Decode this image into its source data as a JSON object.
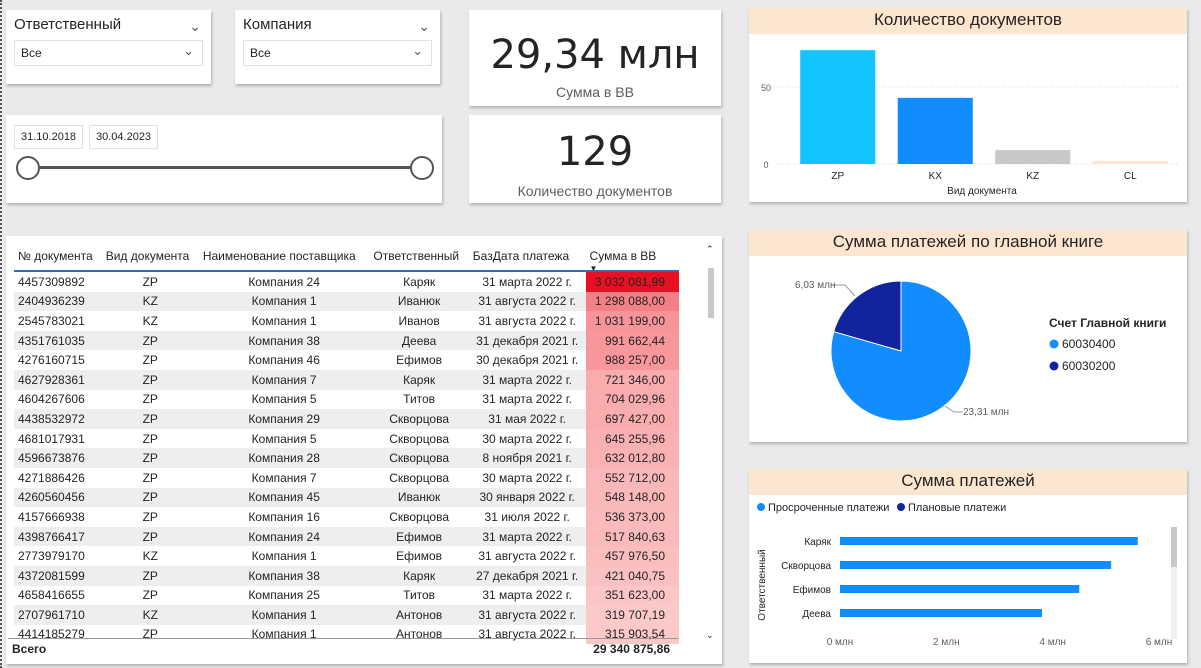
{
  "slicer_responsible": {
    "title": "Ответственный",
    "value": "Все"
  },
  "slicer_company": {
    "title": "Компания",
    "value": "Все"
  },
  "date_range": {
    "start": "31.10.2018",
    "end": "30.04.2023"
  },
  "kpi_sum": {
    "value": "29,34 млн",
    "label": "Сумма в ВВ"
  },
  "kpi_count": {
    "value": "129",
    "label": "Количество документов"
  },
  "table": {
    "columns": [
      "№ документа",
      "Вид документа",
      "Наименование поставщика",
      "Ответственный",
      "БазДата платежа",
      "Сумма в ВВ"
    ],
    "rows": [
      [
        "4457309892",
        "ZP",
        "Компания 24",
        "Каряк",
        "31 марта 2022 г.",
        "3 032 081,99"
      ],
      [
        "2404936239",
        "KZ",
        "Компания 1",
        "Иванюк",
        "31 августа 2022 г.",
        "1 298 088,00"
      ],
      [
        "2545783021",
        "KZ",
        "Компания 1",
        "Иванов",
        "31 августа 2022 г.",
        "1 031 199,00"
      ],
      [
        "4351761035",
        "ZP",
        "Компания 38",
        "Деева",
        "31 декабря 2021 г.",
        "991 662,44"
      ],
      [
        "4276160715",
        "ZP",
        "Компания 46",
        "Ефимов",
        "30 декабря 2021 г.",
        "988 257,00"
      ],
      [
        "4627928361",
        "ZP",
        "Компания 7",
        "Каряк",
        "31 марта 2022 г.",
        "721 346,00"
      ],
      [
        "4604267606",
        "ZP",
        "Компания 5",
        "Титов",
        "31 марта 2022 г.",
        "704 029,96"
      ],
      [
        "4438532972",
        "ZP",
        "Компания 29",
        "Скворцова",
        "31 мая 2022 г.",
        "697 427,00"
      ],
      [
        "4681017931",
        "ZP",
        "Компания 5",
        "Скворцова",
        "30 марта 2022 г.",
        "645 255,96"
      ],
      [
        "4596673876",
        "ZP",
        "Компания 28",
        "Скворцова",
        "8 ноября 2021 г.",
        "632 012,80"
      ],
      [
        "4271886426",
        "ZP",
        "Компания 7",
        "Скворцова",
        "30 марта 2022 г.",
        "552 712,00"
      ],
      [
        "4260560456",
        "ZP",
        "Компания 45",
        "Иванюк",
        "30 января 2022 г.",
        "548 148,00"
      ],
      [
        "4157666938",
        "ZP",
        "Компания 16",
        "Скворцова",
        "31 июля 2022 г.",
        "536 373,00"
      ],
      [
        "4398766417",
        "ZP",
        "Компания 24",
        "Ефимов",
        "31 марта 2022 г.",
        "517 840,63"
      ],
      [
        "2773979170",
        "KZ",
        "Компания 1",
        "Ефимов",
        "31 августа 2022 г.",
        "457 976,50"
      ],
      [
        "4372081599",
        "ZP",
        "Компания 38",
        "Каряк",
        "27 декабря 2021 г.",
        "421 040,75"
      ],
      [
        "4658416655",
        "ZP",
        "Компания 25",
        "Титов",
        "31 марта 2022 г.",
        "351 623,00"
      ],
      [
        "2707961710",
        "KZ",
        "Компания 1",
        "Антонов",
        "31 августа 2022 г.",
        "319 707,19"
      ],
      [
        "4414185279",
        "ZP",
        "Компания 1",
        "Антонов",
        "31 августа 2022 г.",
        "315 903,54"
      ]
    ],
    "amount_values": [
      3032081.99,
      1298088.0,
      1031199.0,
      991662.44,
      988257.0,
      721346.0,
      704029.96,
      697427.0,
      645255.96,
      632012.8,
      552712.0,
      548148.0,
      536373.0,
      517840.63,
      457976.5,
      421040.75,
      351623.0,
      319707.19,
      315903.54
    ],
    "total_label": "Всего",
    "total_value": "29 340 875,86",
    "colors": {
      "max": "#e81123",
      "min": "#fcc9c9"
    }
  },
  "chart_data": [
    {
      "type": "bar",
      "title": "Количество документов",
      "xlabel": "Вид документа",
      "ylabel": "",
      "categories": [
        "ZP",
        "KX",
        "KZ",
        "CL"
      ],
      "values": [
        74,
        43,
        9,
        2
      ],
      "colors": [
        "#12c4ff",
        "#118dff",
        "#c8c8c8",
        "#fde6d0"
      ],
      "ylim": [
        0,
        78
      ],
      "yticks": [
        "0",
        "50"
      ],
      "grid": true
    },
    {
      "type": "pie",
      "title": "Сумма платежей по главной книге",
      "legend_title": "Счет Главной книги",
      "legend_position": "right",
      "slices": [
        {
          "name": "60030400",
          "value": 23.31,
          "label": "23,31 млн",
          "color": "#118dff"
        },
        {
          "name": "60030200",
          "value": 6.03,
          "label": "6,03 млн",
          "color": "#12239e"
        }
      ]
    },
    {
      "type": "bar",
      "orientation": "horizontal",
      "title": "Сумма платежей",
      "ylabel": "Ответственный",
      "legend_position": "top-left",
      "legend": [
        {
          "name": "Просроченные платежи",
          "color": "#118dff"
        },
        {
          "name": "Плановые платежи",
          "color": "#12239e"
        }
      ],
      "categories": [
        "Каряк",
        "Скворцова",
        "Ефимов",
        "Деева"
      ],
      "series": [
        {
          "name": "Просроченные платежи",
          "values": [
            5.6,
            5.1,
            4.5,
            3.8
          ]
        }
      ],
      "xlim": [
        0,
        6
      ],
      "xticks": [
        "0 млн",
        "2 млн",
        "4 млн",
        "6 млн"
      ]
    }
  ]
}
